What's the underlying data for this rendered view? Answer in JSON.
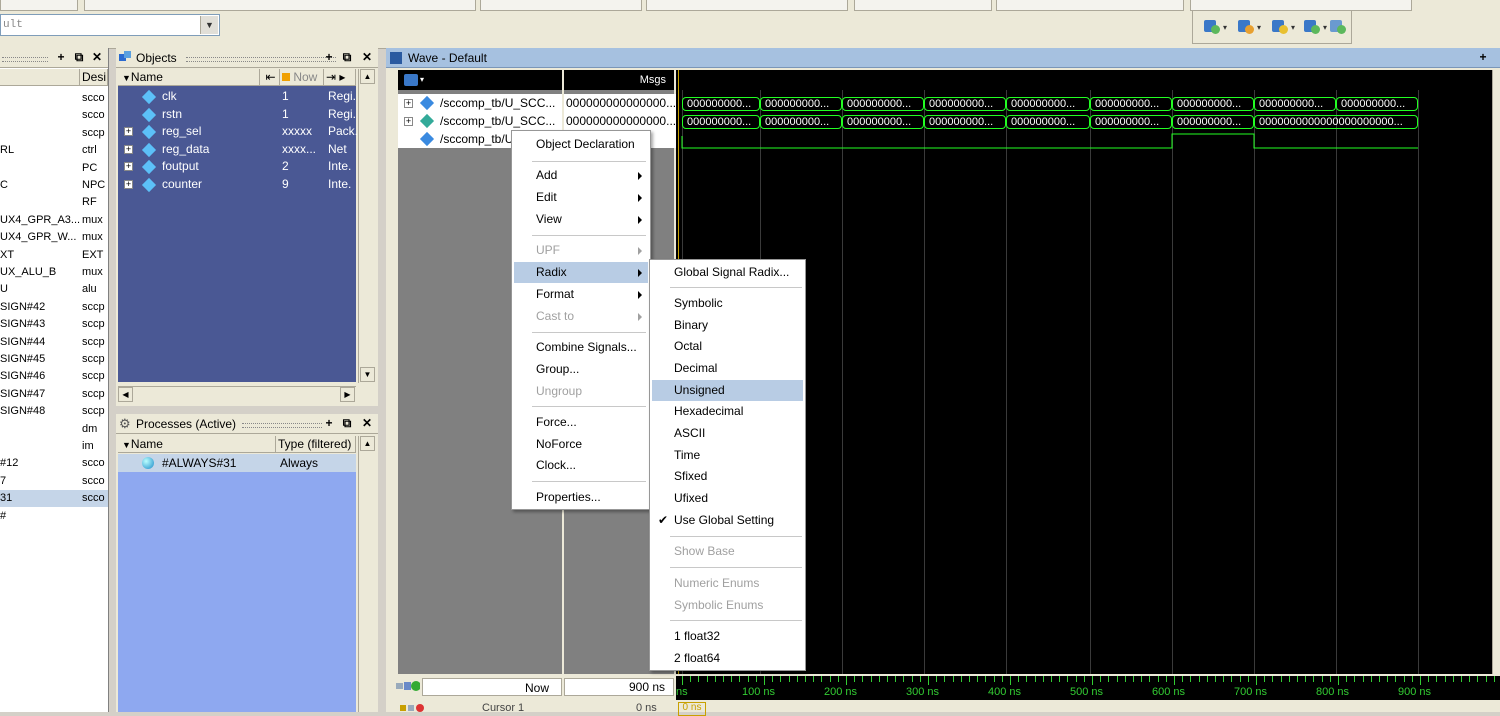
{
  "combo": {
    "text": "ult"
  },
  "sim_panel": {
    "col_design": "Desi",
    "rows": [
      {
        "name": "",
        "design": "scco"
      },
      {
        "name": "",
        "design": "scco"
      },
      {
        "name": "",
        "design": "sccp"
      },
      {
        "name": "RL",
        "design": "ctrl"
      },
      {
        "name": "",
        "design": "PC"
      },
      {
        "name": "C",
        "design": "NPC"
      },
      {
        "name": "",
        "design": "RF"
      },
      {
        "name": "UX4_GPR_A3...",
        "design": "mux"
      },
      {
        "name": "UX4_GPR_W...",
        "design": "mux"
      },
      {
        "name": "XT",
        "design": "EXT"
      },
      {
        "name": "UX_ALU_B",
        "design": "mux"
      },
      {
        "name": "U",
        "design": "alu"
      },
      {
        "name": "SIGN#42",
        "design": "sccp"
      },
      {
        "name": "SIGN#43",
        "design": "sccp"
      },
      {
        "name": "SIGN#44",
        "design": "sccp"
      },
      {
        "name": "SIGN#45",
        "design": "sccp"
      },
      {
        "name": "SIGN#46",
        "design": "sccp"
      },
      {
        "name": "SIGN#47",
        "design": "sccp"
      },
      {
        "name": "SIGN#48",
        "design": "sccp"
      },
      {
        "name": "",
        "design": "dm"
      },
      {
        "name": "",
        "design": "im"
      },
      {
        "name": "#12",
        "design": "scco"
      },
      {
        "name": "7",
        "design": "scco"
      },
      {
        "name": "31",
        "design": "scco"
      },
      {
        "name": "#",
        "design": ""
      }
    ]
  },
  "objects": {
    "title": "Objects",
    "col_name": "Name",
    "col_now": "Now",
    "rows": [
      {
        "name": "clk",
        "now": "1",
        "kind": "Regi.",
        "expandable": false
      },
      {
        "name": "rstn",
        "now": "1",
        "kind": "Regi.",
        "expandable": false
      },
      {
        "name": "reg_sel",
        "now": "xxxxx",
        "kind": "Pack.",
        "expandable": true
      },
      {
        "name": "reg_data",
        "now": "xxxx...",
        "kind": "Net",
        "expandable": true
      },
      {
        "name": "foutput",
        "now": "2",
        "kind": "Inte.",
        "expandable": true
      },
      {
        "name": "counter",
        "now": "9",
        "kind": "Inte.",
        "expandable": true
      }
    ]
  },
  "processes": {
    "title": "Processes (Active)",
    "col_name": "Name",
    "col_type": "Type (filtered)",
    "rows": [
      {
        "name": "#ALWAYS#31",
        "type": "Always"
      }
    ]
  },
  "wave": {
    "title": "Wave - Default",
    "msgs_label": "Msgs",
    "signals": [
      {
        "name": "/sccomp_tb/U_SCC...",
        "value": "000000000000000..."
      },
      {
        "name": "/sccomp_tb/U_SCC...",
        "value": "000000000000000..."
      },
      {
        "name": "/sccomp_tb/U",
        "value": ""
      }
    ],
    "bus1_segments": [
      "000000000...",
      "000000000...",
      "000000000...",
      "000000000...",
      "000000000...",
      "000000000...",
      "000000000...",
      "000000000...",
      "000000000..."
    ],
    "bus2_segments": [
      "000000000...",
      "000000000...",
      "000000000...",
      "000000000...",
      "000000000...",
      "000000000...",
      "000000000...",
      "0000000000000000000000..."
    ],
    "now_label": "Now",
    "now_value": "900 ns",
    "cursor_label": "Cursor 1",
    "cursor_value": "0 ns",
    "cursor_box": "0 ns",
    "time_labels": [
      "ns",
      "100 ns",
      "200 ns",
      "300 ns",
      "400 ns",
      "500 ns",
      "600 ns",
      "700 ns",
      "800 ns",
      "900 ns"
    ]
  },
  "context_menu": {
    "items": {
      "object_declaration": "Object Declaration",
      "add": "Add",
      "edit": "Edit",
      "view": "View",
      "upf": "UPF",
      "radix": "Radix",
      "format": "Format",
      "cast_to": "Cast to",
      "combine_signals": "Combine Signals...",
      "group": "Group...",
      "ungroup": "Ungroup",
      "force": "Force...",
      "noforce": "NoForce",
      "clock": "Clock...",
      "properties": "Properties..."
    }
  },
  "radix_menu": {
    "items": {
      "global_signal_radix": "Global Signal Radix...",
      "symbolic": "Symbolic",
      "binary": "Binary",
      "octal": "Octal",
      "decimal": "Decimal",
      "unsigned": "Unsigned",
      "hexadecimal": "Hexadecimal",
      "ascii": "ASCII",
      "time": "Time",
      "sfixed": "Sfixed",
      "ufixed": "Ufixed",
      "use_global_setting": "Use Global Setting",
      "show_base": "Show Base",
      "numeric_enums": "Numeric Enums",
      "symbolic_enums": "Symbolic Enums",
      "float32": "1 float32",
      "float64": "2 float64"
    }
  },
  "colors": {
    "wave_green": "#22ff22",
    "cursor_yellow": "#c8a000",
    "menu_highlight": "#b8cce4",
    "objects_bg": "#4a5894"
  }
}
